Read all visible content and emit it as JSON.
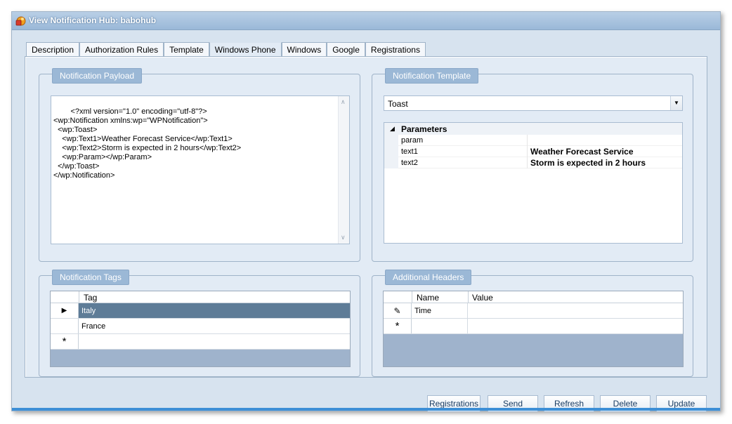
{
  "window": {
    "title": "View Notification Hub: babohub"
  },
  "tabs": [
    {
      "label": "Description"
    },
    {
      "label": "Authorization Rules"
    },
    {
      "label": "Template"
    },
    {
      "label": "Windows Phone",
      "active": true
    },
    {
      "label": "Windows"
    },
    {
      "label": "Google"
    },
    {
      "label": "Registrations"
    }
  ],
  "payload": {
    "title": "Notification Payload",
    "xml": "<?xml version=\"1.0\" encoding=\"utf-8\"?>\n<wp:Notification xmlns:wp=\"WPNotification\">\n  <wp:Toast>\n    <wp:Text1>Weather Forecast Service</wp:Text1>\n    <wp:Text2>Storm is expected in 2 hours</wp:Text2>\n    <wp:Param></wp:Param>\n  </wp:Toast>\n</wp:Notification>"
  },
  "template": {
    "title": "Notification Template",
    "selected": "Toast",
    "category": "Parameters",
    "params": [
      {
        "name": "param",
        "value": ""
      },
      {
        "name": "text1",
        "value": "Weather Forecast Service"
      },
      {
        "name": "text2",
        "value": "Storm is expected in 2 hours"
      }
    ]
  },
  "tags": {
    "title": "Notification Tags",
    "column": "Tag",
    "rows": [
      "Italy",
      "France"
    ],
    "new_row_marker": "*",
    "current_row_marker": "▶"
  },
  "headers": {
    "title": "Additional Headers",
    "columns": [
      "Name",
      "Value"
    ],
    "rows": [
      {
        "name": "Time",
        "value": ""
      }
    ],
    "edit_marker": "✎",
    "new_row_marker": "*"
  },
  "buttons": {
    "registrations": "Registrations",
    "send": "Send",
    "refresh": "Refresh",
    "delete": "Delete",
    "update": "Update"
  },
  "colors": {
    "accent": "#3d8fd6",
    "group_title_bg": "#9bb8d6",
    "selected_row": "#5e7c97"
  }
}
